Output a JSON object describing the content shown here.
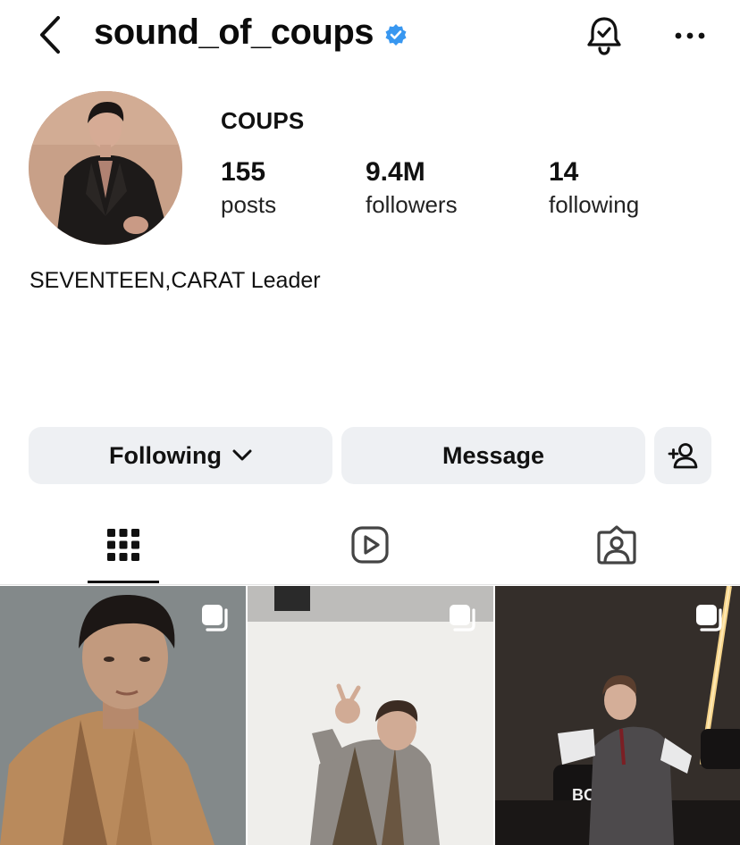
{
  "header": {
    "username": "sound_of_coups",
    "back_icon": "chevron-left-icon",
    "verified_icon": "verified-badge-icon",
    "bell_icon": "bell-check-icon",
    "more_icon": "more-horizontal-icon"
  },
  "profile": {
    "display_name": "COUPS",
    "stats": {
      "posts": {
        "value": "155",
        "label": "posts"
      },
      "followers": {
        "value": "9.4M",
        "label": "followers"
      },
      "following": {
        "value": "14",
        "label": "following"
      }
    },
    "bio": "SEVENTEEN,CARAT Leader"
  },
  "actions": {
    "following_label": "Following",
    "message_label": "Message",
    "add_user_icon": "add-user-icon"
  },
  "tabs": [
    {
      "name": "grid",
      "icon": "grid-icon",
      "active": true
    },
    {
      "name": "reels",
      "icon": "reels-icon",
      "active": false
    },
    {
      "name": "tagged",
      "icon": "tagged-icon",
      "active": false
    }
  ],
  "colors": {
    "accent_verified": "#3897f0",
    "button_bg": "#eef0f3",
    "text": "#111111"
  },
  "posts": [
    {
      "type": "carousel",
      "icon": "multiple-photos-icon"
    },
    {
      "type": "carousel",
      "icon": "multiple-photos-icon"
    },
    {
      "type": "carousel",
      "icon": "multiple-photos-icon"
    }
  ]
}
